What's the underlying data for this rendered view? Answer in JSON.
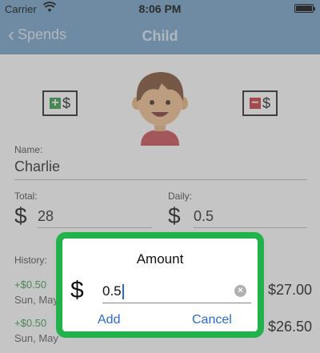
{
  "status_bar": {
    "carrier": "Carrier",
    "time": "8:06 PM"
  },
  "nav": {
    "back_label": "Spends",
    "title": "Child"
  },
  "child": {
    "name_label": "Name:",
    "name": "Charlie",
    "total_label": "Total:",
    "total_currency": "$",
    "total": "28",
    "daily_label": "Daily:",
    "daily_currency": "$",
    "daily": "0.5"
  },
  "adjust": {
    "add_symbol": "$",
    "remove_symbol": "$"
  },
  "history": {
    "label": "History:",
    "items": [
      {
        "amount": "+$0.50",
        "date": "Sun, May",
        "total": "$27.00"
      },
      {
        "amount": "+$0.50",
        "date": "Sun, May",
        "total": "$26.50"
      }
    ]
  },
  "dialog": {
    "title": "Amount",
    "currency": "$",
    "value": "0.5",
    "add_label": "Add",
    "cancel_label": "Cancel"
  },
  "colors": {
    "nav_bg": "#6f9ec6",
    "accent_green": "#21b24c",
    "link_blue": "#2a6ad7",
    "plus_green": "#2f9a48",
    "minus_red": "#c7333a"
  }
}
